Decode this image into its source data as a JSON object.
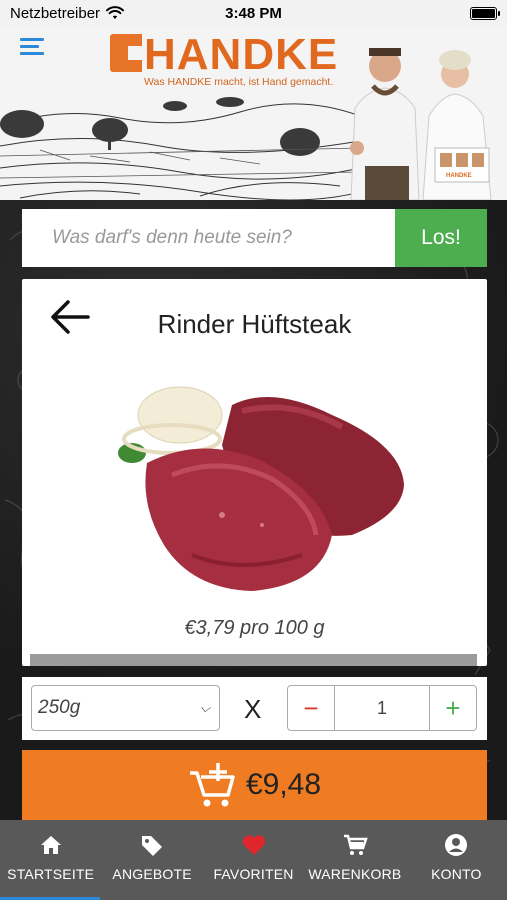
{
  "status_bar": {
    "carrier": "Netzbetreiber",
    "time": "3:48 PM"
  },
  "header": {
    "brand": "HANDKE",
    "tagline": "Was HANDKE macht, ist Hand gemacht.",
    "box_label": "HANDKE"
  },
  "search": {
    "placeholder": "Was darf's denn heute sein?",
    "button_label": "Los!"
  },
  "product": {
    "name": "Rinder Hüftsteak",
    "price_text": "€3,79 pro 100 g"
  },
  "order": {
    "weight_selected": "250g",
    "times_symbol": "X",
    "quantity": "1",
    "minus_symbol": "−",
    "plus_symbol": "+"
  },
  "cart": {
    "total": "€9,48"
  },
  "nav": {
    "items": [
      {
        "label": "STARTSEITE",
        "icon": "home-icon"
      },
      {
        "label": "ANGEBOTE",
        "icon": "tag-icon"
      },
      {
        "label": "FAVORITEN",
        "icon": "heart-icon"
      },
      {
        "label": "WARENKORB",
        "icon": "cart-icon"
      },
      {
        "label": "KONTO",
        "icon": "account-icon"
      }
    ]
  },
  "colors": {
    "brand_orange": "#e0691f",
    "accent_blue": "#2d89d8",
    "go_green": "#4cae4f",
    "cart_orange": "#ef7c22",
    "nav_gray": "#595959",
    "favorite_red": "#e0262b"
  }
}
